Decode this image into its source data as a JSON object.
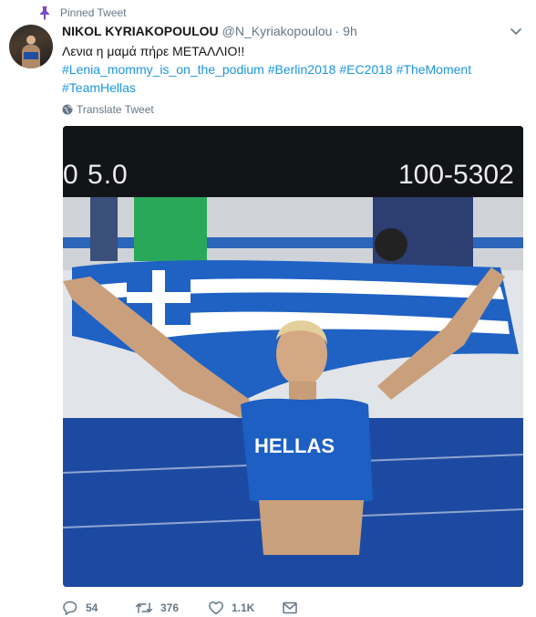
{
  "pinned_label": "Pinned Tweet",
  "author": {
    "name": "NIKOL KYRIAKOPOULOU",
    "handle": "@N_Kyriakopoulou",
    "separator": "·",
    "time": "9h"
  },
  "tweet": {
    "line1": "Λενια η μαμά πήρε ΜΕΤΑΛΛΙΟ!!",
    "hashtags_line1": [
      "#Lenia_mommy_is_on_the_podium",
      "#Berlin2018",
      "#EC2018",
      "#TheMoment"
    ],
    "hashtags_line2": [
      "#TeamHellas"
    ]
  },
  "translate_label": "Translate Tweet",
  "media": {
    "scoreboard_left": "0   5.0",
    "scoreboard_right": "100-5302",
    "jersey_text": "HELLAS"
  },
  "actions": {
    "replies": "54",
    "retweets": "376",
    "likes": "1.1K"
  },
  "icons": {
    "pin": "pin-icon",
    "caret": "chevron-down-icon",
    "translate": "globe-icon",
    "reply": "reply-icon",
    "retweet": "retweet-icon",
    "like": "heart-icon",
    "dm": "envelope-icon"
  },
  "colors": {
    "link": "#1b95e0",
    "muted": "#657786",
    "pin": "#794bc4"
  }
}
